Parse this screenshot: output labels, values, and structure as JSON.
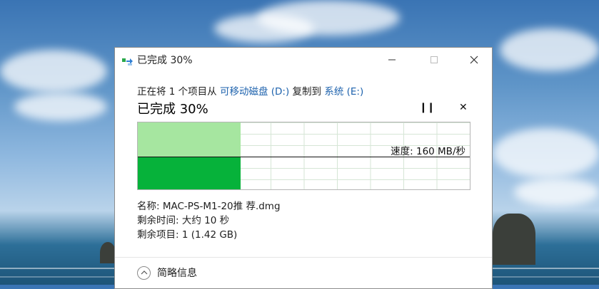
{
  "window": {
    "title": "已完成 30%"
  },
  "status_line": {
    "prefix": "正在将 1 个项目从 ",
    "source": "可移动磁盘 (D:)",
    "middle": " 复制到 ",
    "destination": "系统 (E:)"
  },
  "progress": {
    "heading": "已完成 30%",
    "fraction": 0.31,
    "speed_label": "速度: 160 MB/秒"
  },
  "details": {
    "name": "名称: MAC-PS-M1-20推 荐.dmg",
    "time_remaining": "剩余时间: 大约 10 秒",
    "items_remaining": "剩余项目: 1 (1.42 GB)"
  },
  "footer": {
    "toggle_label": "简略信息"
  },
  "colors": {
    "progress_light": "#a6e6a0",
    "progress_dark": "#06b23a",
    "link": "#1d62ad"
  }
}
